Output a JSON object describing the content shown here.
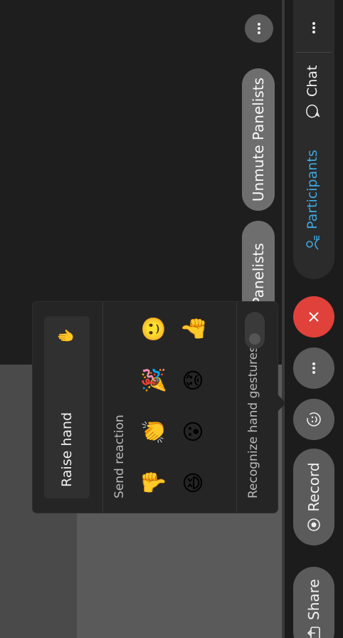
{
  "toolbar": {
    "share_label": "Share",
    "record_label": "Record",
    "reactions_icon": "smiley-reaction-icon",
    "more_icon": "ellipsis-icon",
    "end_icon": "close-icon",
    "end_color": "#e0413a",
    "participants_label": "Participants",
    "participants_color": "#3fa9e0",
    "chat_label": "Chat"
  },
  "video": {
    "unmute_panelists_partial": "ute Panelists",
    "unmute_panelists": "Unmute Panelists"
  },
  "reaction_panel": {
    "raise_hand_label": "Raise hand",
    "send_reaction_label": "Send reaction",
    "reactions_row1": [
      "👎",
      "👏",
      "🎉",
      "🙂"
    ],
    "reactions_row2": [
      "😆",
      "😮",
      "😟",
      "👍"
    ],
    "recognize_label": "Recognize hand gestures",
    "recognize_enabled": false
  }
}
